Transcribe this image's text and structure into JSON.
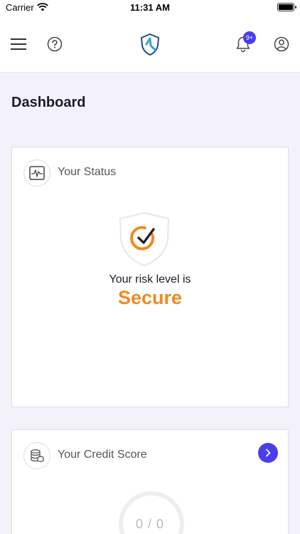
{
  "status_bar": {
    "carrier": "Carrier",
    "time": "11:31 AM"
  },
  "header": {
    "notification_badge": "9+",
    "icons": [
      "menu-icon",
      "help-icon",
      "logo-icon",
      "bell-icon",
      "profile-icon"
    ]
  },
  "page": {
    "title": "Dashboard"
  },
  "status_card": {
    "title": "Your Status",
    "risk_label": "Your risk level is",
    "risk_value": "Secure",
    "risk_color": "#f08a1c"
  },
  "credit_card": {
    "title": "Your Credit Score",
    "score": "0 / 0"
  },
  "colors": {
    "accent": "#4a3df0",
    "background": "#f3f2fb",
    "secure": "#f08a1c"
  }
}
